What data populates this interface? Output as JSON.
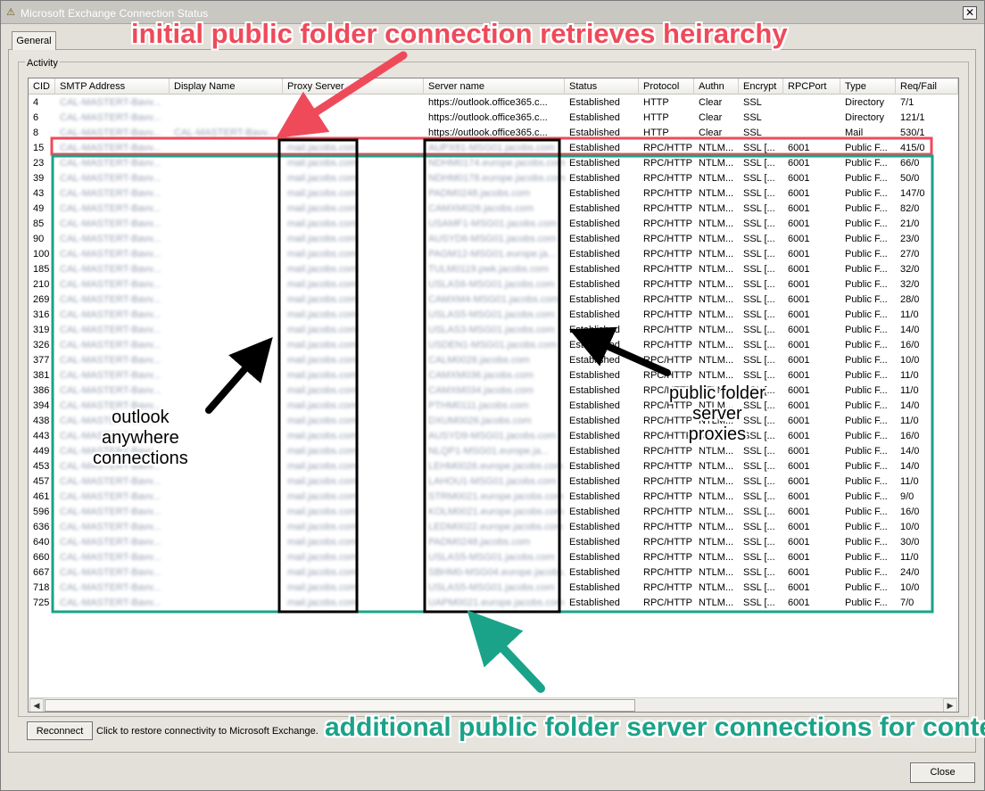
{
  "window": {
    "title": "Microsoft Exchange Connection Status",
    "close_glyph": "✕",
    "icon": "exchange-warning-icon"
  },
  "tabs": [
    {
      "label": "General"
    }
  ],
  "activity": {
    "group_label": "Activity",
    "columns": [
      "CID",
      "SMTP Address",
      "Display Name",
      "Proxy Server",
      "Server name",
      "Status",
      "Protocol",
      "Authn",
      "Encrypt",
      "RPCPort",
      "Type",
      "Req/Fail"
    ],
    "rows": [
      {
        "cid": "4",
        "smtp": "CAL-MASTERT-Bavv...",
        "display": "",
        "proxy": "",
        "server": "https://outlook.office365.c...",
        "status": "Established",
        "protocol": "HTTP",
        "authn": "Clear",
        "encrypt": "SSL",
        "rpcport": "",
        "type": "Directory",
        "reqfail": "7/1"
      },
      {
        "cid": "6",
        "smtp": "CAL-MASTERT-Bavv...",
        "display": "",
        "proxy": "",
        "server": "https://outlook.office365.c...",
        "status": "Established",
        "protocol": "HTTP",
        "authn": "Clear",
        "encrypt": "SSL",
        "rpcport": "",
        "type": "Directory",
        "reqfail": "121/1"
      },
      {
        "cid": "8",
        "smtp": "CAL-MASTERT-Bavv...",
        "display": "CAL-MASTERT-Bavv...",
        "proxy": "",
        "server": "https://outlook.office365.c...",
        "status": "Established",
        "protocol": "HTTP",
        "authn": "Clear",
        "encrypt": "SSL",
        "rpcport": "",
        "type": "Mail",
        "reqfail": "530/1"
      },
      {
        "cid": "15",
        "smtp": "CAL-MASTERT-Bavv...",
        "display": "",
        "proxy": "mail.jacobs.com",
        "server": "AUPX81-MSG01.jacobs.com",
        "status": "Established",
        "protocol": "RPC/HTTP",
        "authn": "NTLM...",
        "encrypt": "SSL [...",
        "rpcport": "6001",
        "type": "Public F...",
        "reqfail": "415/0"
      },
      {
        "cid": "23",
        "smtp": "CAL-MASTERT-Bavv...",
        "display": "",
        "proxy": "mail.jacobs.com",
        "server": "NDHM0174.europe.jacobs.com",
        "status": "Established",
        "protocol": "RPC/HTTP",
        "authn": "NTLM...",
        "encrypt": "SSL [...",
        "rpcport": "6001",
        "type": "Public F...",
        "reqfail": "66/0"
      },
      {
        "cid": "39",
        "smtp": "CAL-MASTERT-Bavv...",
        "display": "",
        "proxy": "mail.jacobs.com",
        "server": "NDHM0178.europe.jacobs.com",
        "status": "Established",
        "protocol": "RPC/HTTP",
        "authn": "NTLM...",
        "encrypt": "SSL [...",
        "rpcport": "6001",
        "type": "Public F...",
        "reqfail": "50/0"
      },
      {
        "cid": "43",
        "smtp": "CAL-MASTERT-Bavv...",
        "display": "",
        "proxy": "mail.jacobs.com",
        "server": "PADM0248.jacobs.com",
        "status": "Established",
        "protocol": "RPC/HTTP",
        "authn": "NTLM...",
        "encrypt": "SSL [...",
        "rpcport": "6001",
        "type": "Public F...",
        "reqfail": "147/0"
      },
      {
        "cid": "49",
        "smtp": "CAL-MASTERT-Bavv...",
        "display": "",
        "proxy": "mail.jacobs.com",
        "server": "CAMXM026.jacobs.com",
        "status": "Established",
        "protocol": "RPC/HTTP",
        "authn": "NTLM...",
        "encrypt": "SSL [...",
        "rpcport": "6001",
        "type": "Public F...",
        "reqfail": "82/0"
      },
      {
        "cid": "85",
        "smtp": "CAL-MASTERT-Bavv...",
        "display": "",
        "proxy": "mail.jacobs.com",
        "server": "USAMF1-MSG01.jacobs.com",
        "status": "Established",
        "protocol": "RPC/HTTP",
        "authn": "NTLM...",
        "encrypt": "SSL [...",
        "rpcport": "6001",
        "type": "Public F...",
        "reqfail": "21/0"
      },
      {
        "cid": "90",
        "smtp": "CAL-MASTERT-Bavv...",
        "display": "",
        "proxy": "mail.jacobs.com",
        "server": "AUSYD6-MSG01.jacobs.com",
        "status": "Established",
        "protocol": "RPC/HTTP",
        "authn": "NTLM...",
        "encrypt": "SSL [...",
        "rpcport": "6001",
        "type": "Public F...",
        "reqfail": "23/0"
      },
      {
        "cid": "100",
        "smtp": "CAL-MASTERT-Bavv...",
        "display": "",
        "proxy": "mail.jacobs.com",
        "server": "PAGM12-MSG01.europe.ja...",
        "status": "Established",
        "protocol": "RPC/HTTP",
        "authn": "NTLM...",
        "encrypt": "SSL [...",
        "rpcport": "6001",
        "type": "Public F...",
        "reqfail": "27/0"
      },
      {
        "cid": "185",
        "smtp": "CAL-MASTERT-Bavv...",
        "display": "",
        "proxy": "mail.jacobs.com",
        "server": "TULM0119.pwk.jacobs.com",
        "status": "Established",
        "protocol": "RPC/HTTP",
        "authn": "NTLM...",
        "encrypt": "SSL [...",
        "rpcport": "6001",
        "type": "Public F...",
        "reqfail": "32/0"
      },
      {
        "cid": "210",
        "smtp": "CAL-MASTERT-Bavv...",
        "display": "",
        "proxy": "mail.jacobs.com",
        "server": "USLAS6-MSG01.jacobs.com",
        "status": "Established",
        "protocol": "RPC/HTTP",
        "authn": "NTLM...",
        "encrypt": "SSL [...",
        "rpcport": "6001",
        "type": "Public F...",
        "reqfail": "32/0"
      },
      {
        "cid": "269",
        "smtp": "CAL-MASTERT-Bavv...",
        "display": "",
        "proxy": "mail.jacobs.com",
        "server": "CAMXM4-MSG01.jacobs.com",
        "status": "Established",
        "protocol": "RPC/HTTP",
        "authn": "NTLM...",
        "encrypt": "SSL [...",
        "rpcport": "6001",
        "type": "Public F...",
        "reqfail": "28/0"
      },
      {
        "cid": "316",
        "smtp": "CAL-MASTERT-Bavv...",
        "display": "",
        "proxy": "mail.jacobs.com",
        "server": "USLAS5-MSG01.jacobs.com",
        "status": "Established",
        "protocol": "RPC/HTTP",
        "authn": "NTLM...",
        "encrypt": "SSL [...",
        "rpcport": "6001",
        "type": "Public F...",
        "reqfail": "11/0"
      },
      {
        "cid": "319",
        "smtp": "CAL-MASTERT-Bavv...",
        "display": "",
        "proxy": "mail.jacobs.com",
        "server": "USLAS3-MSG01.jacobs.com",
        "status": "Established",
        "protocol": "RPC/HTTP",
        "authn": "NTLM...",
        "encrypt": "SSL [...",
        "rpcport": "6001",
        "type": "Public F...",
        "reqfail": "14/0"
      },
      {
        "cid": "326",
        "smtp": "CAL-MASTERT-Bavv...",
        "display": "",
        "proxy": "mail.jacobs.com",
        "server": "USDEN1-MSG01.jacobs.com",
        "status": "Established",
        "protocol": "RPC/HTTP",
        "authn": "NTLM...",
        "encrypt": "SSL [...",
        "rpcport": "6001",
        "type": "Public F...",
        "reqfail": "16/0"
      },
      {
        "cid": "377",
        "smtp": "CAL-MASTERT-Bavv...",
        "display": "",
        "proxy": "mail.jacobs.com",
        "server": "CALM0026.jacobs.com",
        "status": "Established",
        "protocol": "RPC/HTTP",
        "authn": "NTLM...",
        "encrypt": "SSL [...",
        "rpcport": "6001",
        "type": "Public F...",
        "reqfail": "10/0"
      },
      {
        "cid": "381",
        "smtp": "CAL-MASTERT-Bavv...",
        "display": "",
        "proxy": "mail.jacobs.com",
        "server": "CAMXM036.jacobs.com",
        "status": "Established",
        "protocol": "RPC/HTTP",
        "authn": "NTLM...",
        "encrypt": "SSL [...",
        "rpcport": "6001",
        "type": "Public F...",
        "reqfail": "11/0"
      },
      {
        "cid": "386",
        "smtp": "CAL-MASTERT-Bavv...",
        "display": "",
        "proxy": "mail.jacobs.com",
        "server": "CAMXM034.jacobs.com",
        "status": "Established",
        "protocol": "RPC/HTTP",
        "authn": "NTLM...",
        "encrypt": "SSL [...",
        "rpcport": "6001",
        "type": "Public F...",
        "reqfail": "11/0"
      },
      {
        "cid": "394",
        "smtp": "CAL-MASTERT-Bavv...",
        "display": "",
        "proxy": "mail.jacobs.com",
        "server": "PTHM0111.jacobs.com",
        "status": "Established",
        "protocol": "RPC/HTTP",
        "authn": "NTLM...",
        "encrypt": "SSL [...",
        "rpcport": "6001",
        "type": "Public F...",
        "reqfail": "14/0"
      },
      {
        "cid": "438",
        "smtp": "CAL-MASTERT-Bavv...",
        "display": "",
        "proxy": "mail.jacobs.com",
        "server": "DXUM0026.jacobs.com",
        "status": "Established",
        "protocol": "RPC/HTTP",
        "authn": "NTLM...",
        "encrypt": "SSL [...",
        "rpcport": "6001",
        "type": "Public F...",
        "reqfail": "11/0"
      },
      {
        "cid": "443",
        "smtp": "CAL-MASTERT-Bavv...",
        "display": "",
        "proxy": "mail.jacobs.com",
        "server": "AUSYD9-MSG01.jacobs.com",
        "status": "Established",
        "protocol": "RPC/HTTP",
        "authn": "NTLM...",
        "encrypt": "SSL [...",
        "rpcport": "6001",
        "type": "Public F...",
        "reqfail": "16/0"
      },
      {
        "cid": "449",
        "smtp": "CAL-MASTERT-Bavv...",
        "display": "",
        "proxy": "mail.jacobs.com",
        "server": "NLQP1-MSG01.europe.ja...",
        "status": "Established",
        "protocol": "RPC/HTTP",
        "authn": "NTLM...",
        "encrypt": "SSL [...",
        "rpcport": "6001",
        "type": "Public F...",
        "reqfail": "14/0"
      },
      {
        "cid": "453",
        "smtp": "CAL-MASTERT-Bavv...",
        "display": "",
        "proxy": "mail.jacobs.com",
        "server": "LEHM0026.europe.jacobs.com",
        "status": "Established",
        "protocol": "RPC/HTTP",
        "authn": "NTLM...",
        "encrypt": "SSL [...",
        "rpcport": "6001",
        "type": "Public F...",
        "reqfail": "14/0"
      },
      {
        "cid": "457",
        "smtp": "CAL-MASTERT-Bavv...",
        "display": "",
        "proxy": "mail.jacobs.com",
        "server": "LAHOU1-MSG01.jacobs.com",
        "status": "Established",
        "protocol": "RPC/HTTP",
        "authn": "NTLM...",
        "encrypt": "SSL [...",
        "rpcport": "6001",
        "type": "Public F...",
        "reqfail": "11/0"
      },
      {
        "cid": "461",
        "smtp": "CAL-MASTERT-Bavv...",
        "display": "",
        "proxy": "mail.jacobs.com",
        "server": "STRM0021.europe.jacobs.com",
        "status": "Established",
        "protocol": "RPC/HTTP",
        "authn": "NTLM...",
        "encrypt": "SSL [...",
        "rpcport": "6001",
        "type": "Public F...",
        "reqfail": "9/0"
      },
      {
        "cid": "596",
        "smtp": "CAL-MASTERT-Bavv...",
        "display": "",
        "proxy": "mail.jacobs.com",
        "server": "KOLM0021.europe.jacobs.com",
        "status": "Established",
        "protocol": "RPC/HTTP",
        "authn": "NTLM...",
        "encrypt": "SSL [...",
        "rpcport": "6001",
        "type": "Public F...",
        "reqfail": "16/0"
      },
      {
        "cid": "636",
        "smtp": "CAL-MASTERT-Bavv...",
        "display": "",
        "proxy": "mail.jacobs.com",
        "server": "LEDM0022.europe.jacobs.com",
        "status": "Established",
        "protocol": "RPC/HTTP",
        "authn": "NTLM...",
        "encrypt": "SSL [...",
        "rpcport": "6001",
        "type": "Public F...",
        "reqfail": "10/0"
      },
      {
        "cid": "640",
        "smtp": "CAL-MASTERT-Bavv...",
        "display": "",
        "proxy": "mail.jacobs.com",
        "server": "PADM0248.jacobs.com",
        "status": "Established",
        "protocol": "RPC/HTTP",
        "authn": "NTLM...",
        "encrypt": "SSL [...",
        "rpcport": "6001",
        "type": "Public F...",
        "reqfail": "30/0"
      },
      {
        "cid": "660",
        "smtp": "CAL-MASTERT-Bavv...",
        "display": "",
        "proxy": "mail.jacobs.com",
        "server": "USLAS5-MSG01.jacobs.com",
        "status": "Established",
        "protocol": "RPC/HTTP",
        "authn": "NTLM...",
        "encrypt": "SSL [...",
        "rpcport": "6001",
        "type": "Public F...",
        "reqfail": "11/0"
      },
      {
        "cid": "667",
        "smtp": "CAL-MASTERT-Bavv...",
        "display": "",
        "proxy": "mail.jacobs.com",
        "server": "SBHM0-MSG04.europe.jacobs.com",
        "status": "Established",
        "protocol": "RPC/HTTP",
        "authn": "NTLM...",
        "encrypt": "SSL [...",
        "rpcport": "6001",
        "type": "Public F...",
        "reqfail": "24/0"
      },
      {
        "cid": "718",
        "smtp": "CAL-MASTERT-Bavv...",
        "display": "",
        "proxy": "mail.jacobs.com",
        "server": "USLAS5-MSG01.jacobs.com",
        "status": "Established",
        "protocol": "RPC/HTTP",
        "authn": "NTLM...",
        "encrypt": "SSL [...",
        "rpcport": "6001",
        "type": "Public F...",
        "reqfail": "10/0"
      },
      {
        "cid": "725",
        "smtp": "CAL-MASTERT-Bavv...",
        "display": "",
        "proxy": "mail.jacobs.com",
        "server": "UAPM0021.europe.jacobs.com",
        "status": "Established",
        "protocol": "RPC/HTTP",
        "authn": "NTLM...",
        "encrypt": "SSL [...",
        "rpcport": "6001",
        "type": "Public F...",
        "reqfail": "7/0"
      }
    ]
  },
  "footer": {
    "reconnect_label": "Reconnect",
    "reconnect_hint": "Click to restore connectivity to Microsoft Exchange.",
    "close_label": "Close"
  },
  "annotations": {
    "red_callout": "initial public folder connection retrieves heirarchy",
    "green_callout": "additional public folder server connections for content",
    "outlook_lines": [
      "outlook",
      "anywhere",
      "connections"
    ],
    "proxy_lines": [
      "public folder",
      "server",
      "proxies"
    ],
    "colors": {
      "red": "#ef4a5a",
      "green": "#1aa388",
      "black": "#000000"
    }
  }
}
